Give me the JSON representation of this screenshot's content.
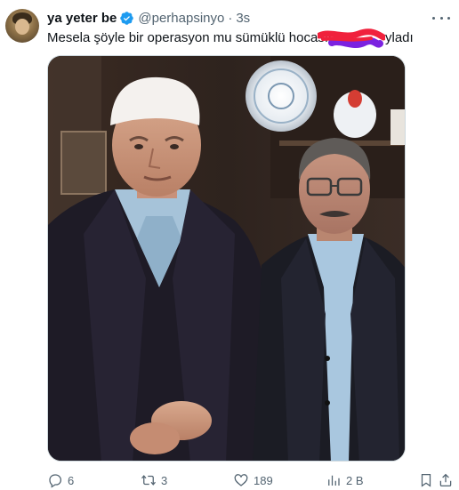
{
  "tweet": {
    "display_name": "ya yeter be",
    "handle": "@perhapsinyo",
    "separator": "·",
    "time": "3s",
    "text": "Mesela şöyle bir operasyon mu sümüklü hocasını",
    "text_tail": "yladı",
    "actions": {
      "reply_count": "6",
      "retweet_count": "3",
      "like_count": "189",
      "views_count": "2 B"
    }
  },
  "colors": {
    "verified": "#1d9bf0",
    "muted": "#536471",
    "redaction_red": "#f0213c",
    "redaction_purple": "#7b22e0"
  },
  "icons": [
    "verified-badge-icon",
    "more-icon",
    "reply-icon",
    "retweet-icon",
    "like-icon",
    "views-icon",
    "bookmark-icon",
    "share-icon"
  ]
}
